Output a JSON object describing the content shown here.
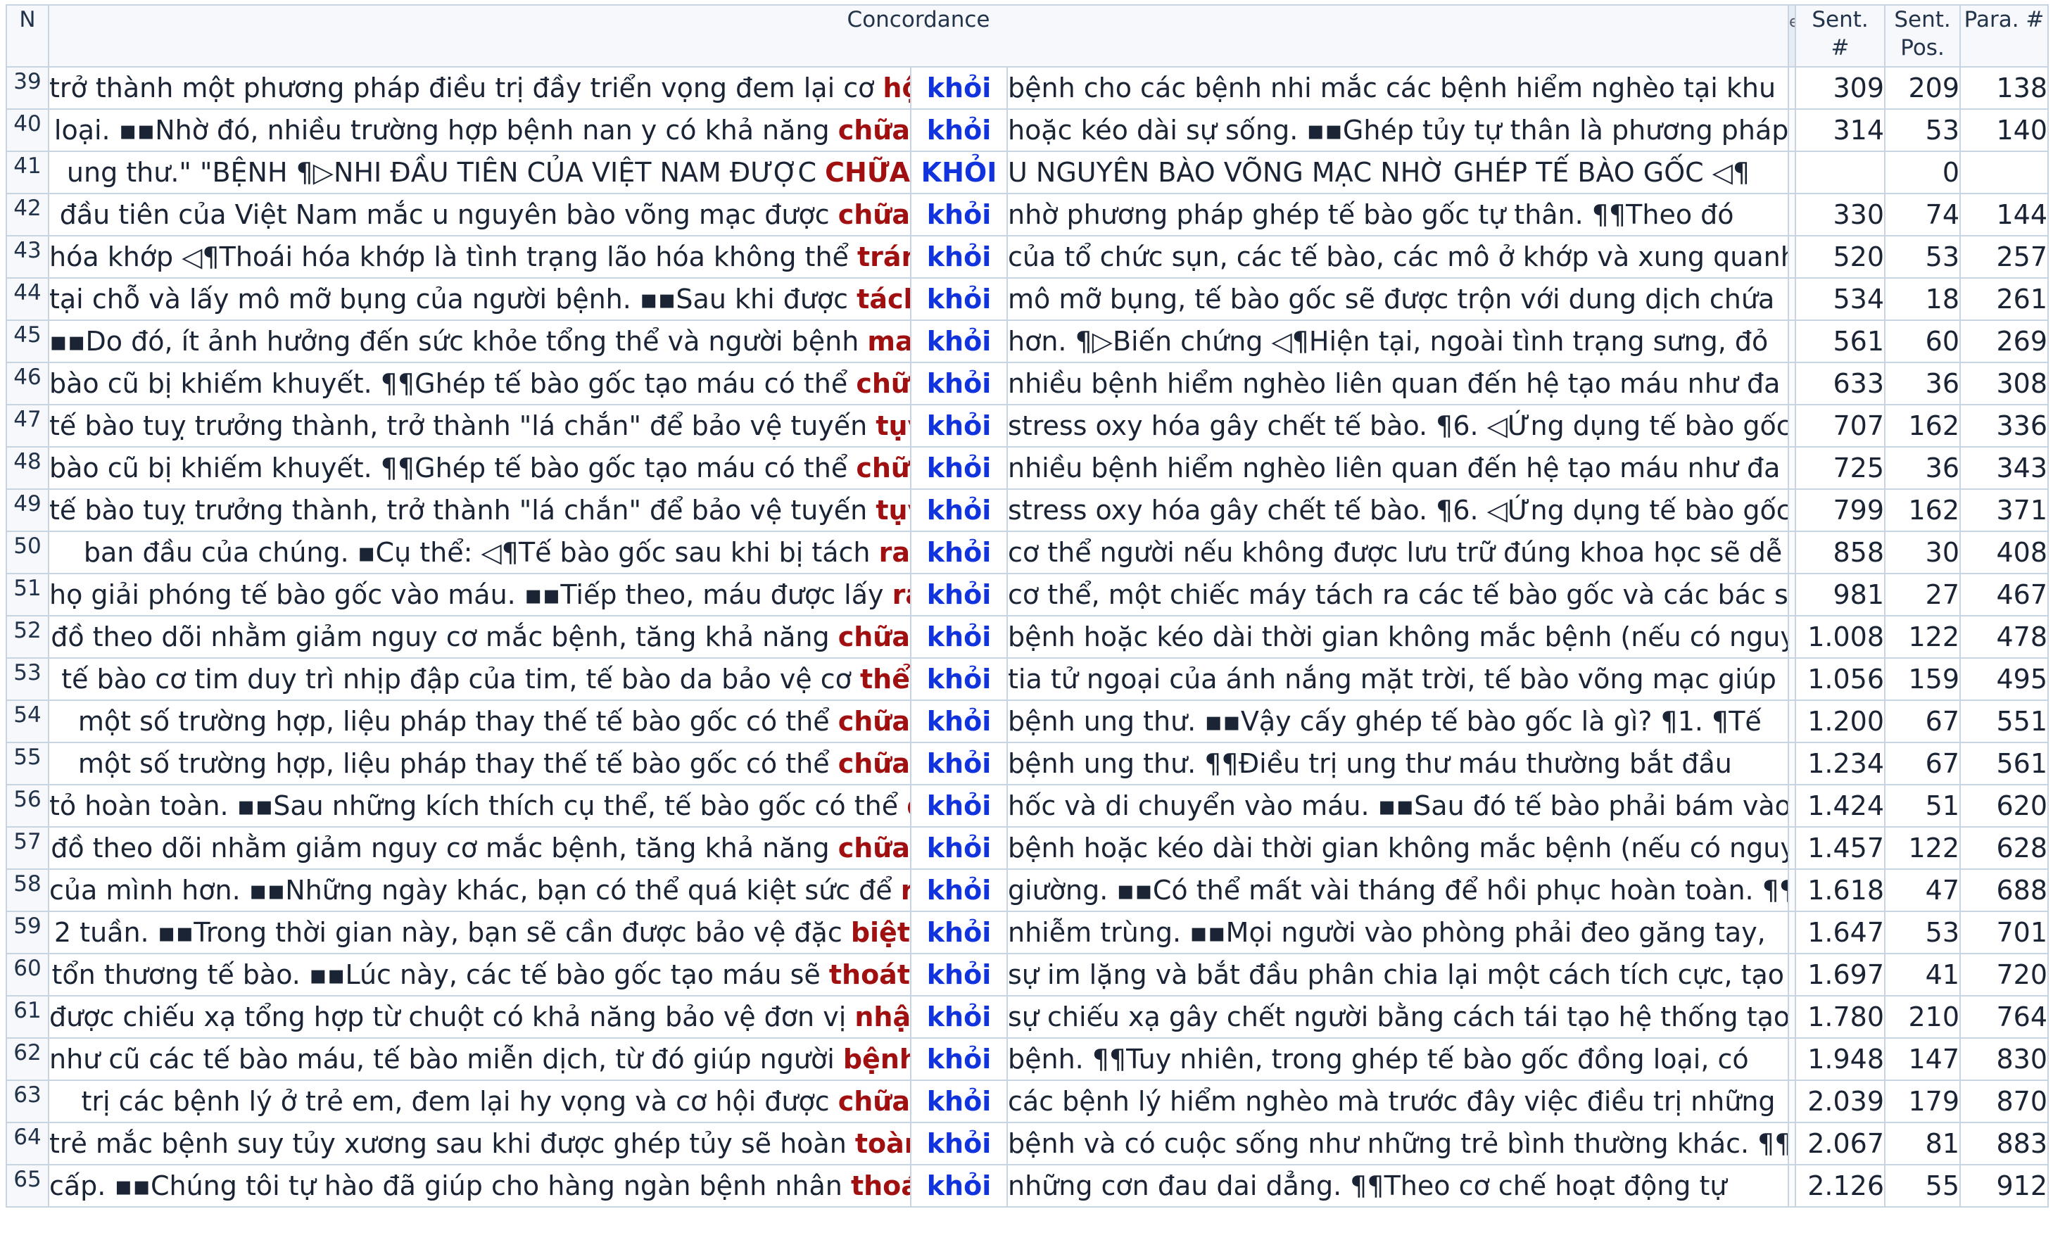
{
  "headers": {
    "n": "N",
    "concordance": "Concordance",
    "sent_no": [
      "Sent.",
      "#"
    ],
    "sent_pos": [
      "Sent.",
      "Pos."
    ],
    "para_no": "Para. #"
  },
  "rows": [
    {
      "n": "39",
      "left": "trở thành một phương pháp điều trị đầy triển vọng đem lại cơ ",
      "hl": "hội",
      "key": "khỏi",
      "right": "bệnh cho các bệnh nhi mắc các bệnh hiểm nghèo tại khu",
      "sent": "309",
      "pos": "209",
      "para": "138"
    },
    {
      "n": "40",
      "left": "loại. ▪▪Nhờ đó, nhiều trường hợp bệnh nan y có khả năng ",
      "hl": "chữa",
      "key": "khỏi",
      "right": "hoặc kéo dài sự sống. ▪▪Ghép tủy tự thân là phương pháp",
      "sent": "314",
      "pos": "53",
      "para": "140"
    },
    {
      "n": "41",
      "left": "ung thư.\" \"BỆNH ¶▷NHI ĐẦU TIÊN CỦA VIỆT NAM ĐƯỢC ",
      "hl": "CHỮA",
      "key": "KHỎI",
      "right": "U NGUYÊN BÀO VÕNG MẠC NHỜ GHÉP TẾ BÀO GỐC ◁¶",
      "sent": "",
      "pos": "0",
      "para": ""
    },
    {
      "n": "42",
      "left": "đầu tiên của Việt Nam mắc u nguyên bào võng mạc được ",
      "hl": "chữa",
      "key": "khỏi",
      "right": "nhờ phương pháp ghép tế bào gốc tự thân. ¶¶Theo đó",
      "sent": "330",
      "pos": "74",
      "para": "144"
    },
    {
      "n": "43",
      "left": "hóa khớp ◁¶Thoái hóa khớp là tình trạng lão hóa không thể ",
      "hl": "tránh",
      "key": "khỏi",
      "right": "của tổ chức sụn, các tế bào, các mô ở khớp và xung quanh",
      "sent": "520",
      "pos": "53",
      "para": "257"
    },
    {
      "n": "44",
      "left": "tại chỗ và lấy mô mỡ bụng của người bệnh. ▪▪Sau khi được ",
      "hl": "tách",
      "key": "khỏi",
      "right": "mô mỡ bụng, tế bào gốc sẽ được trộn với dung dịch chứa",
      "sent": "534",
      "pos": "18",
      "para": "261"
    },
    {
      "n": "45",
      "left": "▪▪Do đó, ít ảnh hưởng đến sức khỏe tổng thể và người bệnh ",
      "hl": "mau",
      "key": "khỏi",
      "right": "hơn. ¶▷Biến chứng ◁¶Hiện tại, ngoài tình trạng sưng, đỏ",
      "sent": "561",
      "pos": "60",
      "para": "269"
    },
    {
      "n": "46",
      "left": "bào cũ bị khiếm khuyết. ¶¶Ghép tế bào gốc tạo máu có thể ",
      "hl": "chữa",
      "key": "khỏi",
      "right": "nhiều bệnh hiểm nghèo liên quan đến hệ tạo máu như đa",
      "sent": "633",
      "pos": "36",
      "para": "308"
    },
    {
      "n": "47",
      "left": "tế bào tuỵ trưởng thành, trở thành \"lá chắn\" để bảo vệ tuyến ",
      "hl": "tụy",
      "key": "khỏi",
      "right": "stress oxy hóa gây chết tế bào. ¶6. ◁Ứng dụng tế bào gốc",
      "sent": "707",
      "pos": "162",
      "para": "336"
    },
    {
      "n": "48",
      "left": "bào cũ bị khiếm khuyết. ¶¶Ghép tế bào gốc tạo máu có thể ",
      "hl": "chữa",
      "key": "khỏi",
      "right": "nhiều bệnh hiểm nghèo liên quan đến hệ tạo máu như đa",
      "sent": "725",
      "pos": "36",
      "para": "343"
    },
    {
      "n": "49",
      "left": "tế bào tuỵ trưởng thành, trở thành \"lá chắn\" để bảo vệ tuyến ",
      "hl": "tụy",
      "key": "khỏi",
      "right": "stress oxy hóa gây chết tế bào. ¶6. ◁Ứng dụng tế bào gốc",
      "sent": "799",
      "pos": "162",
      "para": "371"
    },
    {
      "n": "50",
      "left": "ban đầu của chúng. ▪Cụ thể: ◁¶Tế bào gốc sau khi bị tách ",
      "hl": "ra",
      "key": "khỏi",
      "right": "cơ thể người nếu không được lưu trữ đúng khoa học sẽ dễ",
      "sent": "858",
      "pos": "30",
      "para": "408"
    },
    {
      "n": "51",
      "left": "họ giải phóng tế bào gốc vào máu. ▪▪Tiếp theo, máu được lấy ",
      "hl": "ra",
      "key": "khỏi",
      "right": "cơ thể, một chiếc máy tách ra các tế bào gốc và các bác sĩ",
      "sent": "981",
      "pos": "27",
      "para": "467"
    },
    {
      "n": "52",
      "left": "đồ theo dõi nhằm giảm nguy cơ mắc bệnh, tăng khả năng ",
      "hl": "chữa",
      "key": "khỏi",
      "right": "bệnh hoặc kéo dài thời gian không mắc bệnh (nếu có nguy",
      "sent": "1.008",
      "pos": "122",
      "para": "478"
    },
    {
      "n": "53",
      "left": "tế bào cơ tim duy trì nhịp đập của tim, tế bào da bảo vệ cơ ",
      "hl": "thể",
      "key": "khỏi",
      "right": "tia tử ngoại của ánh nắng mặt trời, tế bào võng mạc giúp",
      "sent": "1.056",
      "pos": "159",
      "para": "495"
    },
    {
      "n": "54",
      "left": "một số trường hợp, liệu pháp thay thế tế bào gốc có thể ",
      "hl": "chữa",
      "key": "khỏi",
      "right": "bệnh ung thư. ▪▪Vậy cấy ghép tế bào gốc là gì? ¶1. ¶Tế",
      "sent": "1.200",
      "pos": "67",
      "para": "551"
    },
    {
      "n": "55",
      "left": "một số trường hợp, liệu pháp thay thế tế bào gốc có thể ",
      "hl": "chữa",
      "key": "khỏi",
      "right": "bệnh ung thư. ¶¶Điều trị ung thư máu thường bắt đầu",
      "sent": "1.234",
      "pos": "67",
      "para": "561"
    },
    {
      "n": "56",
      "left": "tỏ hoàn toàn. ▪▪Sau những kích thích cụ thể, tế bào gốc có thể ",
      "hl": "dời",
      "key": "khỏi",
      "right": "hốc và di chuyển vào máu. ▪▪Sau đó tế bào phải bám vào",
      "sent": "1.424",
      "pos": "51",
      "para": "620"
    },
    {
      "n": "57",
      "left": "đồ theo dõi nhằm giảm nguy cơ mắc bệnh, tăng khả năng ",
      "hl": "chữa",
      "key": "khỏi",
      "right": "bệnh hoặc kéo dài thời gian không mắc bệnh (nếu có nguy",
      "sent": "1.457",
      "pos": "122",
      "para": "628"
    },
    {
      "n": "58",
      "left": "của mình hơn. ▪▪Những ngày khác, bạn có thể quá kiệt sức để ",
      "hl": "ra",
      "key": "khỏi",
      "right": "giường. ▪▪Có thể mất vài tháng để hồi phục hoàn toàn. ¶¶",
      "sent": "1.618",
      "pos": "47",
      "para": "688"
    },
    {
      "n": "59",
      "left": "2 tuần. ▪▪Trong thời gian này, bạn sẽ cần được bảo vệ đặc ",
      "hl": "biệt",
      "key": "khỏi",
      "right": "nhiễm trùng. ▪▪Mọi người vào phòng phải đeo găng tay,",
      "sent": "1.647",
      "pos": "53",
      "para": "701"
    },
    {
      "n": "60",
      "left": "tổn thương tế bào. ▪▪Lúc này, các tế bào gốc tạo máu sẽ ",
      "hl": "thoát",
      "key": "khỏi",
      "right": "sự im lặng và bắt đầu phân chia lại một cách tích cực, tạo",
      "sent": "1.697",
      "pos": "41",
      "para": "720"
    },
    {
      "n": "61",
      "left": "được chiếu xạ tổng hợp từ chuột có khả năng bảo vệ đơn vị ",
      "hl": "nhận",
      "key": "khỏi",
      "right": "sự chiếu xạ gây chết người bằng cách tái tạo hệ thống tạo",
      "sent": "1.780",
      "pos": "210",
      "para": "764"
    },
    {
      "n": "62",
      "left": "như cũ các tế bào máu, tế bào miễn dịch, từ đó giúp người ",
      "hl": "bệnh",
      "key": "khỏi",
      "right": "bệnh. ¶¶Tuy nhiên, trong ghép tế bào gốc đồng loại, có",
      "sent": "1.948",
      "pos": "147",
      "para": "830"
    },
    {
      "n": "63",
      "left": "trị các bệnh lý ở trẻ em, đem lại hy vọng và cơ hội được ",
      "hl": "chữa",
      "key": "khỏi",
      "right": "các bệnh lý hiểm nghèo mà trước đây việc điều trị những",
      "sent": "2.039",
      "pos": "179",
      "para": "870"
    },
    {
      "n": "64",
      "left": "trẻ mắc bệnh suy tủy xương sau khi được ghép tủy sẽ hoàn ",
      "hl": "toàn",
      "key": "khỏi",
      "right": "bệnh và có cuộc sống như những trẻ bình thường khác. ¶¶",
      "sent": "2.067",
      "pos": "81",
      "para": "883"
    },
    {
      "n": "65",
      "left": "cấp. ▪▪Chúng tôi tự hào đã giúp cho hàng ngàn bệnh nhân ",
      "hl": "thoát",
      "key": "khỏi",
      "right": "những cơn đau dai dẳng. ¶¶Theo cơ chế hoạt động tự",
      "sent": "2.126",
      "pos": "55",
      "para": "912"
    }
  ]
}
